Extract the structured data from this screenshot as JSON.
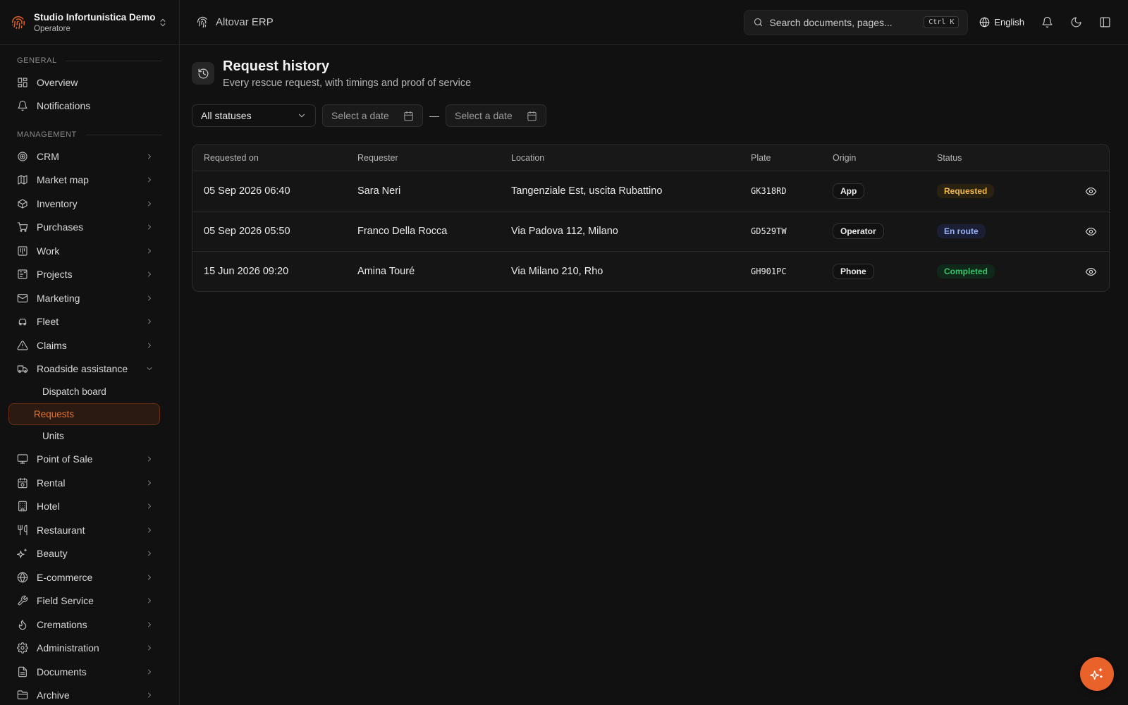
{
  "org": {
    "name": "Studio Infortunistica Demo",
    "role": "Operatore"
  },
  "sidebar": {
    "general_label": "GENERAL",
    "management_label": "MANAGEMENT",
    "general": [
      {
        "label": "Overview",
        "icon": "overview-icon"
      },
      {
        "label": "Notifications",
        "icon": "bell-icon"
      }
    ],
    "management": [
      {
        "label": "CRM",
        "icon": "target-icon"
      },
      {
        "label": "Market map",
        "icon": "map-icon"
      },
      {
        "label": "Inventory",
        "icon": "box-icon"
      },
      {
        "label": "Purchases",
        "icon": "cart-icon"
      },
      {
        "label": "Work",
        "icon": "work-icon"
      },
      {
        "label": "Projects",
        "icon": "projects-icon"
      },
      {
        "label": "Marketing",
        "icon": "mail-icon"
      },
      {
        "label": "Fleet",
        "icon": "car-icon"
      },
      {
        "label": "Claims",
        "icon": "warning-icon"
      },
      {
        "label": "Roadside assistance",
        "icon": "truck-icon",
        "expanded": true,
        "children": [
          "Dispatch board",
          "Requests",
          "Units"
        ],
        "active_child": "Requests"
      },
      {
        "label": "Point of Sale",
        "icon": "monitor-icon"
      },
      {
        "label": "Rental",
        "icon": "rental-icon"
      },
      {
        "label": "Hotel",
        "icon": "hotel-icon"
      },
      {
        "label": "Restaurant",
        "icon": "restaurant-icon"
      },
      {
        "label": "Beauty",
        "icon": "sparkle-icon"
      },
      {
        "label": "E-commerce",
        "icon": "globe-icon"
      },
      {
        "label": "Field Service",
        "icon": "wrench-icon"
      },
      {
        "label": "Cremations",
        "icon": "flame-icon"
      },
      {
        "label": "Administration",
        "icon": "gear-icon"
      },
      {
        "label": "Documents",
        "icon": "document-icon"
      },
      {
        "label": "Archive",
        "icon": "folder-icon"
      }
    ]
  },
  "topbar": {
    "app_title": "Altovar ERP",
    "search_placeholder": "Search documents, pages...",
    "shortcut": "Ctrl K",
    "language": "English"
  },
  "page": {
    "title": "Request history",
    "subtitle": "Every rescue request, with timings and proof of service"
  },
  "filters": {
    "status": "All statuses",
    "date_from": "Select a date",
    "date_to": "Select a date",
    "separator": "—"
  },
  "table": {
    "columns": [
      "Requested on",
      "Requester",
      "Location",
      "Plate",
      "Origin",
      "Status"
    ],
    "rows": [
      {
        "requested_on": "05 Sep 2026 06:40",
        "requester": "Sara Neri",
        "location": "Tangenziale Est, uscita Rubattino",
        "plate": "GK318RD",
        "origin": "App",
        "status": "Requested"
      },
      {
        "requested_on": "05 Sep 2026 05:50",
        "requester": "Franco Della Rocca",
        "location": "Via Padova 112, Milano",
        "plate": "GD529TW",
        "origin": "Operator",
        "status": "En route"
      },
      {
        "requested_on": "15 Jun 2026 09:20",
        "requester": "Amina Touré",
        "location": "Via Milano 210, Rho",
        "plate": "GH901PC",
        "origin": "Phone",
        "status": "Completed"
      }
    ]
  },
  "colors": {
    "accent": "#e8622a",
    "status_requested": "#f2b84a",
    "status_en_route": "#9bb0f5",
    "status_completed": "#39c46b"
  }
}
